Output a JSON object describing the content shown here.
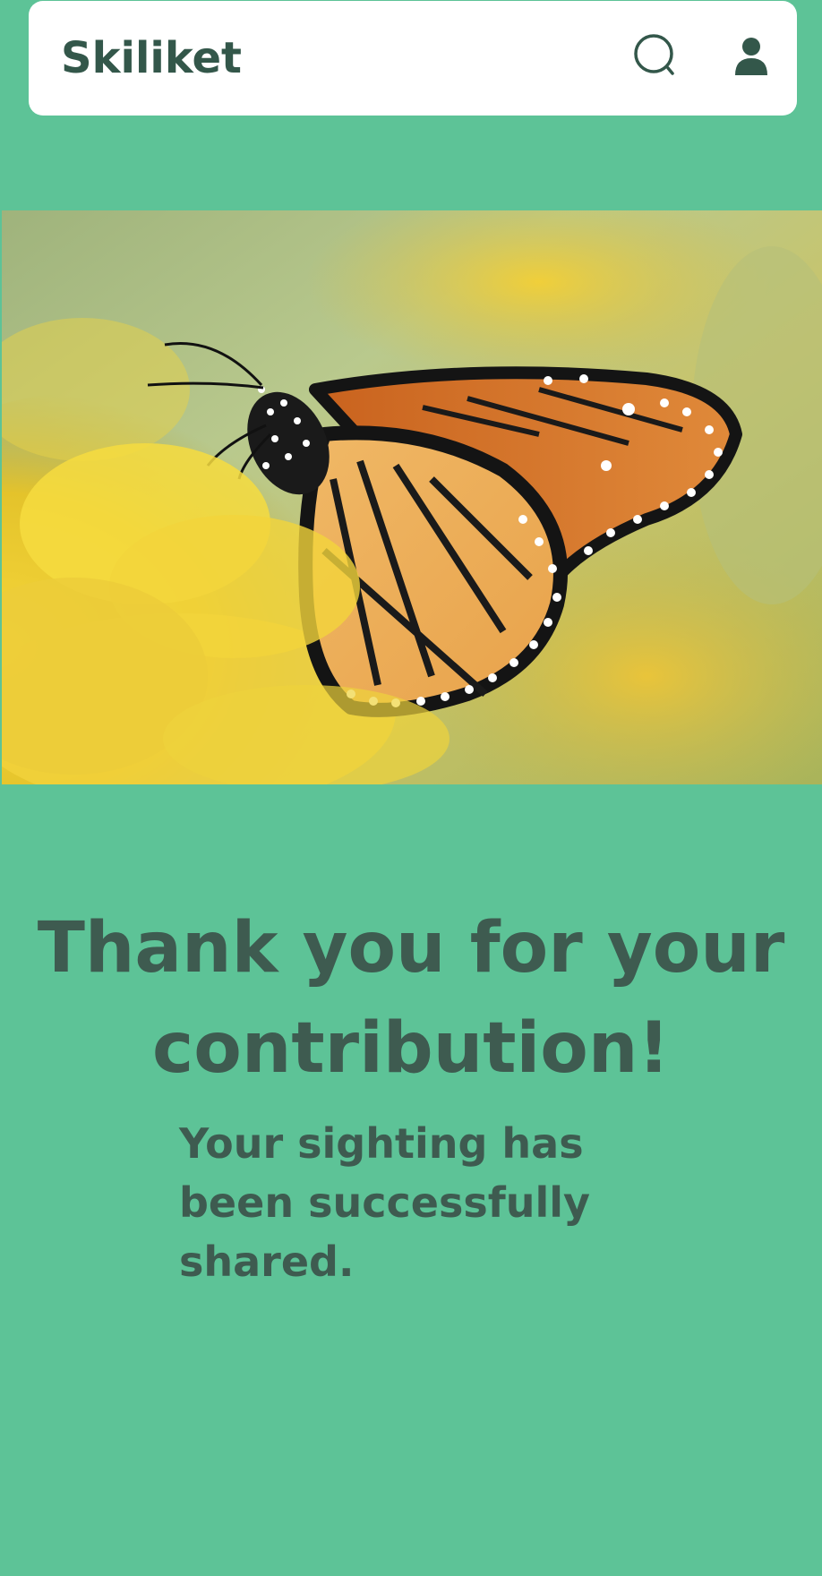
{
  "app": {
    "brand": "Skiliket"
  },
  "header": {
    "search_icon": "search-icon",
    "profile_icon": "user-icon"
  },
  "hero": {
    "image": "monarch-butterfly-on-yellow-flowers"
  },
  "confirmation": {
    "title": "Thank you for your contribution!",
    "message": "Your sighting has been successfully shared."
  },
  "colors": {
    "background": "#5dc397",
    "header_bg": "#ffffff",
    "brand_text": "#33574a",
    "body_text": "#3e5b50"
  }
}
